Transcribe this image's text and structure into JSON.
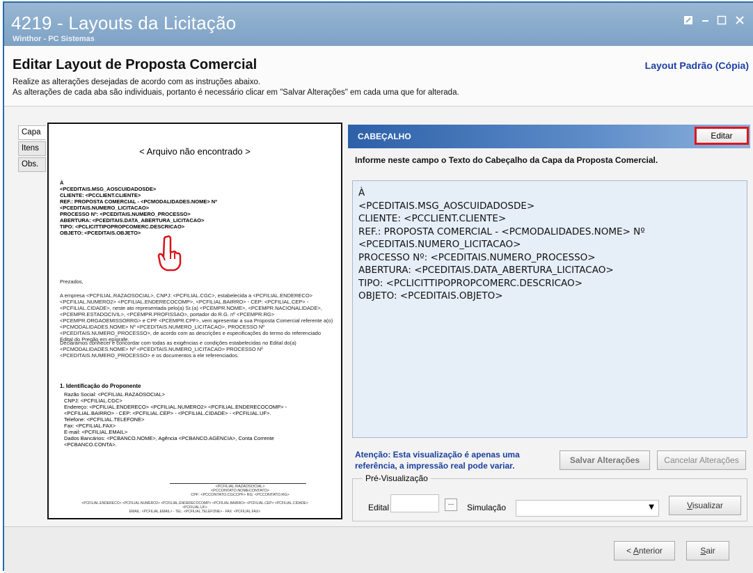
{
  "window": {
    "title": "4219 - Layouts da Licitação",
    "subtitle": "Winthor - PC Sistemas",
    "controls": [
      "restore-icon",
      "minimize-icon",
      "maximize-icon",
      "close-icon"
    ]
  },
  "header": {
    "title": "Editar Layout de Proposta Comercial",
    "layout_name": "Layout Padrão (Cópia)",
    "instruction_1": "Realize as alterações desejadas de acordo com as instruções abaixo.",
    "instruction_2": "As alterações de cada aba são individuais, portanto é necessário clicar em \"Salvar Alterações\" em cada uma que for alterada."
  },
  "tabs": [
    {
      "label": "Capa",
      "active": true
    },
    {
      "label": "Itens",
      "active": false
    },
    {
      "label": "Obs.",
      "active": false
    }
  ],
  "preview": {
    "not_found": "< Arquivo não encontrado >",
    "header_lines": [
      "À",
      "<PCEDITAIS.MSG_AOSCUIDADOSDE>",
      "CLIENTE: <PCCLIENT.CLIENTE>",
      "REF.: PROPOSTA COMERCIAL - <PCMODALIDADES.NOME> Nº",
      "<PCEDITAIS.NUMERO_LICITACAO>",
      "PROCESSO Nº: <PCEDITAIS.NUMERO_PROCESSO>",
      "ABERTURA: <PCEDITAIS.DATA_ABERTURA_LICITACAO>",
      "TIPO: <PCLICITTIPOPROPCOMERC.DESCRICAO>",
      "OBJETO: <PCEDITAIS.OBJETO>"
    ],
    "greeting": "Prezados,",
    "paragraph_1": "A empresa <PCFILIAL.RAZAOSOCIAL>, CNPJ: <PCFILIAL.CGC>, estabelecida a <PCFILIAL.ENDERECO> <PCFILIAL.NUMERO2> <PCFILIAL.ENDERECOCOMP>, <PCFILIAL.BAIRRO> - CEP: <PCFILIAL.CEP> - <PCFILIAL.CIDADE>, neste ato representada pelo(a) Sr.(a) <PCEMPR.NOME>, <PCEMPR.NACIONALIDADE>, <PCEMPR.ESTADOCIVIL>, <PCEMPR.PROFISSAO>, portador do R.G. nº <PCEMPR.RG> <PCEMPR.ORGAOEMISSORRG> e CPF <PCEMPR.CPF>, vem apresentar a sua Proposta Comercial referente a(o) <PCMODALIDADES.NOME> Nº <PCEDITAIS.NUMERO_LICITACAO>, PROCESSO Nº <PCEDITAIS.NUMERO_PROCESSO>, de acordo com as descrições e especificações do termo do referenciado Edital do Pregão em epígrafe.",
    "paragraph_2": "Declaramos conhecer e concordar com todas as exigências e condições estabelecidas no Edital do(a) <PCMODALIDADES.NOME> Nº <PCEDITAIS.NUMERO_LICITACAO> PROCESSO Nº <PCEDITAIS.NUMERO_PROCESSO> e os documentos a ele referenciados.",
    "section_title": "1. Identificação do Proponente",
    "section_lines": [
      "Razão Social: <PCFILIAL.RAZAOSOCIAL>",
      "CNPJ: <PCFILIAL.CGC>",
      "Endereço: <PCFILIAL.ENDERECO> <PCFILIAL.NUMERO2> <PCFILIAL.ENDERECOCOMP> -",
      "<PCFILIAL.BAIRRO> - CEP: <PCFILIAL.CEP> - <PCFILIAL.CIDADE> - <PCFILIAL.UF>.",
      "Telefone: <PCFILIAL.TELEFONE>",
      "Fax: <PCFILIAL.FAX>",
      "E-mail: <PCFILIAL.EMAIL>",
      "Dados Bancários: <PCBANCO.NOME>, Agência <PCBANCO.AGENCIA>, Conta Corrente",
      "<PCBANCO.CONTA>."
    ],
    "signature_lines": [
      "<PCFILIAL.RAZAOSOCIAL>",
      "<PCCONTATO.NOMECONTATO>",
      "CPF: <PCCONTATO.CGCCPF> RG: <PCCONTATO.RG>"
    ],
    "footer_lines": [
      "<PCFILIAL.ENDERECO> <PCFILIAL.NUMERO2> <PCFILIAL.ENDERECOCOMP> <PCFILIAL.BAIRRO> <PCFILIAL.CEP> <PCFILIAL.CIDADE> <PCFILIAL.UF>",
      "EMAIL: <PCFILIAL.EMAIL> - TEL: <PCFILIAL.TELEFONE> - FAX: <PCFILIAL.FAX>"
    ]
  },
  "cabecalho": {
    "title": "CABEÇALHO",
    "edit_label": "Editar",
    "info": "Informe neste campo o Texto do Cabeçalho da Capa da Proposta Comercial.",
    "lines": [
      "À",
      "<PCEDITAIS.MSG_AOSCUIDADOSDE>",
      "CLIENTE: <PCCLIENT.CLIENTE>",
      "REF.: PROPOSTA COMERCIAL - <PCMODALIDADES.NOME> Nº",
      "<PCEDITAIS.NUMERO_LICITACAO>",
      "PROCESSO Nº: <PCEDITAIS.NUMERO_PROCESSO>",
      "ABERTURA: <PCEDITAIS.DATA_ABERTURA_LICITACAO>",
      "TIPO: <PCLICITTIPOPROPCOMERC.DESCRICAO>",
      "OBJETO: <PCEDITAIS.OBJETO>"
    ],
    "atencao": "Atenção: Esta visualização é apenas uma referência, a impressão real pode variar.",
    "salvar": "Salvar Alterações",
    "cancelar": "Cancelar Alterações"
  },
  "pre_visualizacao": {
    "title": "Pré-Visualização",
    "edital_label": "Edital",
    "edital_value": "",
    "browse_label": "...",
    "simulacao_label": "Simulação",
    "simulacao_value": "",
    "visualizar_u": "V",
    "visualizar_rest": "isualizar"
  },
  "footer": {
    "anterior_prefix": "< ",
    "anterior_u": "A",
    "anterior_rest": "nterior",
    "sair_u": "S",
    "sair_rest": "air"
  },
  "colors": {
    "title_bar": "#8aaccc",
    "cabecalho_bar": "#2d60a8",
    "highlight_border": "#e0141c",
    "layout_name": "#1c3fa6",
    "text_area_bg": "#e6eef8"
  }
}
